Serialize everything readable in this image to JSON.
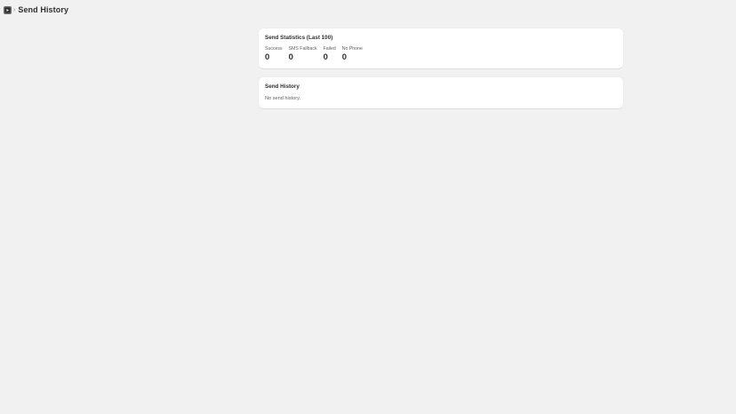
{
  "header": {
    "icon": "app-icon",
    "separator": "›",
    "title": "Send History"
  },
  "stats_card": {
    "title": "Send Statistics (Last 100)",
    "stats": [
      {
        "label": "Success",
        "value": "0"
      },
      {
        "label": "SMS Fallback",
        "value": "0"
      },
      {
        "label": "Failed",
        "value": "0"
      },
      {
        "label": "No Phone",
        "value": "0"
      }
    ]
  },
  "history_card": {
    "title": "Send History",
    "empty_message": "No send history."
  }
}
